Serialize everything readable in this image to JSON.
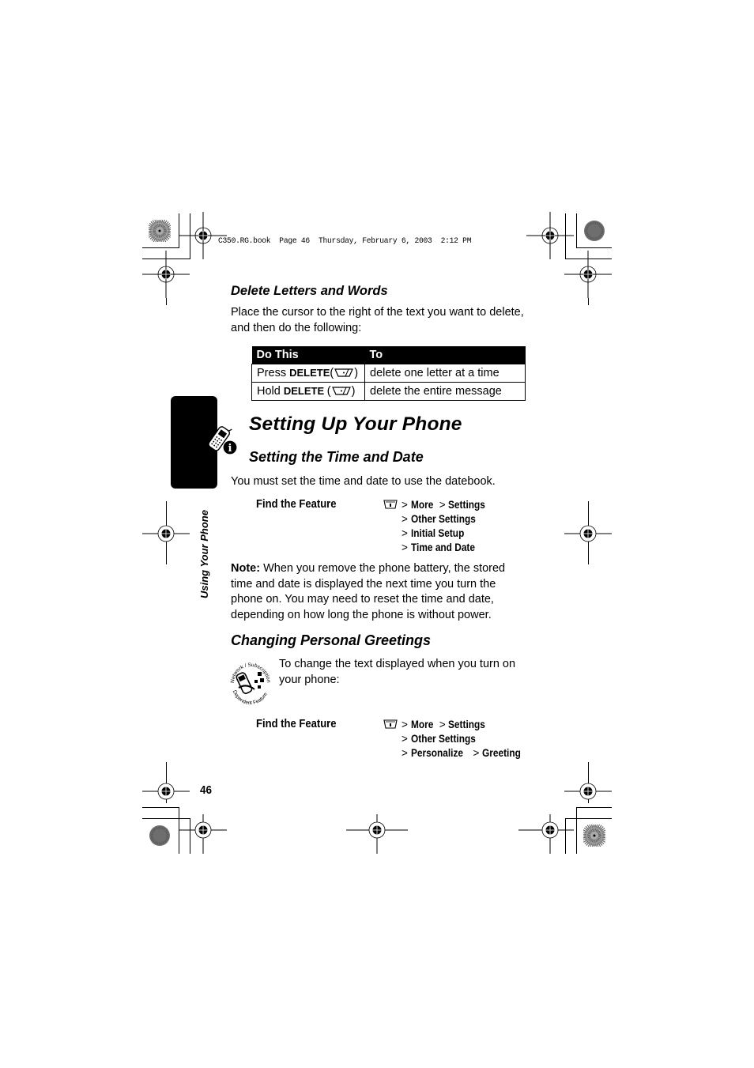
{
  "print_header": "C350.RG.book  Page 46  Thursday, February 6, 2003  2:12 PM",
  "delete_section": {
    "heading": "Delete Letters and Words",
    "intro_line1": "Place the cursor to the right of the text you want to delete,",
    "intro_line2": "and then do the following:",
    "table": {
      "headers": [
        "Do This",
        "To"
      ],
      "rows": [
        {
          "action_prefix": "Press ",
          "action_key": "DELETE",
          "key_icon": "delete-key-icon",
          "result": "delete one letter at a time"
        },
        {
          "action_prefix": "Hold ",
          "action_key": "DELETE ",
          "key_icon": "delete-key-icon",
          "result": "delete the entire message"
        }
      ]
    }
  },
  "chapter": {
    "title": "Setting Up Your Phone",
    "icon": "phone-info-icon",
    "side_label": "Using Your Phone"
  },
  "time_date_section": {
    "heading": "Setting the Time and Date",
    "intro": "You must set the time and date to use the datebook.",
    "find_feature": {
      "label": "Find the Feature",
      "menu_icon": "menu-key-icon",
      "path": [
        [
          {
            "text": "More"
          },
          {
            "text": "Settings"
          }
        ],
        [
          {
            "text": "Other Settings"
          }
        ],
        [
          {
            "text": "Initial Setup"
          }
        ],
        [
          {
            "text": "Time and Date"
          }
        ]
      ]
    },
    "note_label": "Note:",
    "note_lines": [
      " When you remove the phone battery, the stored",
      "time and date is displayed the next time you turn the",
      "phone on. You may need to reset the time and date,",
      "depending on how long the phone is without power."
    ]
  },
  "greetings_section": {
    "heading": "Changing Personal Greetings",
    "badge_icon": "network-subscription-dependent-feature-icon",
    "badge_text_top": "Network / Subscription",
    "badge_text_bottom": "Dependent Feature",
    "intro_line1": "To change the text displayed when you turn on",
    "intro_line2": "your phone:",
    "find_feature": {
      "label": "Find the Feature",
      "menu_icon": "menu-key-icon",
      "path": [
        [
          {
            "text": "More"
          },
          {
            "text": "Settings"
          }
        ],
        [
          {
            "text": "Other Settings"
          }
        ],
        [
          {
            "text": "Personalize"
          },
          {
            "text": "Greeting"
          }
        ]
      ]
    }
  },
  "separator": ">",
  "page_number": "46"
}
